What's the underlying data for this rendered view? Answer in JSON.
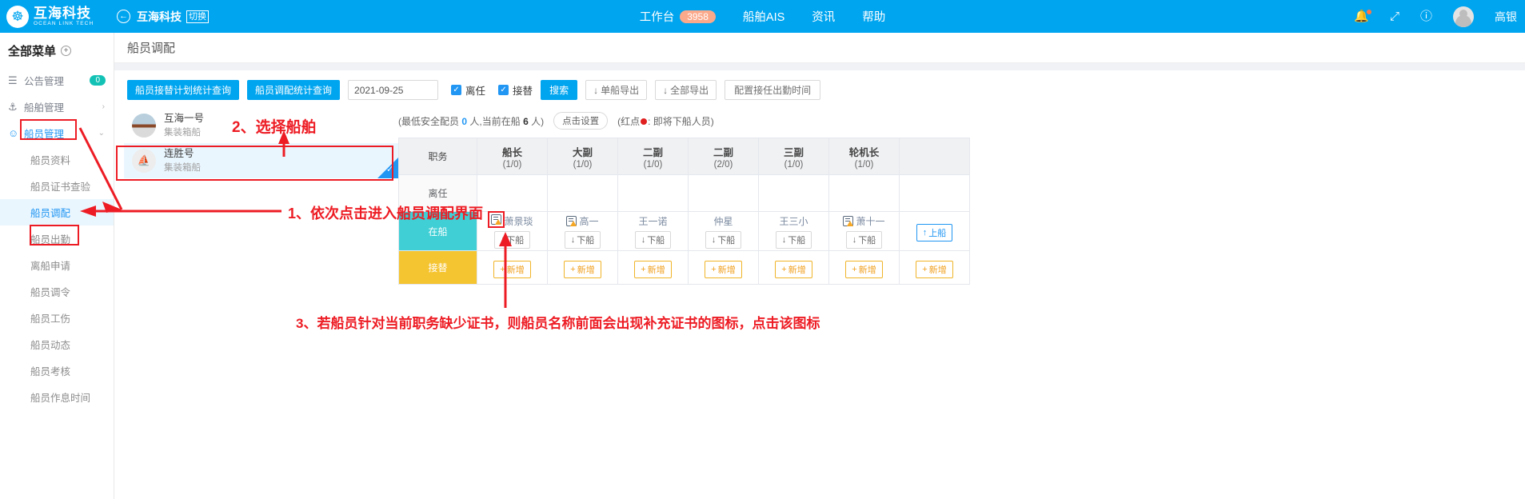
{
  "header": {
    "brand_cn": "互海科技",
    "brand_en": "OCEAN LINK TECH",
    "back_icon": "←",
    "back_name": "互海科技",
    "switch_label": "切换",
    "nav": [
      {
        "label": "工作台",
        "badge": "3958"
      },
      {
        "label": "船舶AIS",
        "badge": ""
      },
      {
        "label": "资讯",
        "badge": ""
      },
      {
        "label": "帮助",
        "badge": ""
      }
    ],
    "bell_icon": "🔔",
    "expand_icon": "⤢",
    "help_icon": "?",
    "user_name": "高银"
  },
  "sidebar": {
    "title": "全部菜单",
    "add_icon": "+",
    "groups": [
      {
        "icon": "☷",
        "label": "公告管理",
        "badge": "0"
      },
      {
        "icon": "⚓",
        "label": "船舶管理",
        "arrow": "›"
      },
      {
        "icon": "☺",
        "label": "船员管理",
        "arrow": "⌄",
        "active": true
      }
    ],
    "sub_items": [
      {
        "label": "船员资料"
      },
      {
        "label": "船员证书查验"
      },
      {
        "label": "船员调配",
        "selected": true
      },
      {
        "label": "船员出勤"
      },
      {
        "label": "离船申请"
      },
      {
        "label": "船员调令"
      },
      {
        "label": "船员工伤"
      },
      {
        "label": "船员动态"
      },
      {
        "label": "船员考核"
      },
      {
        "label": "船员作息时间"
      }
    ]
  },
  "page": {
    "title": "船员调配"
  },
  "toolbar": {
    "btn_plan_query": "船员接替计划统计查询",
    "btn_alloc_query": "船员调配统计查询",
    "date_value": "2021-09-25",
    "chk_leave": "离任",
    "chk_replace": "接替",
    "chk_mark": "✓",
    "btn_search": "搜索",
    "btn_single_export": "单船导出",
    "btn_all_export": "全部导出",
    "btn_config_time": "配置接任出勤时间",
    "download_icon": "↓"
  },
  "ships": [
    {
      "name": "互海一号",
      "type": "集装箱船",
      "selected": false
    },
    {
      "name": "连胜号",
      "type": "集装箱船",
      "selected": true
    }
  ],
  "table_note": {
    "prefix": "(最低安全配员",
    "min_crew": "0",
    "mid": "人,当前在船",
    "onboard_count": "6",
    "suffix": "人)",
    "setting_btn": "点击设置",
    "legend": "(红点",
    "legend_tail": ": 即将下船人员)"
  },
  "table": {
    "row_header_label": "职务",
    "columns": [
      {
        "name": "船长",
        "count": "(1/0)"
      },
      {
        "name": "大副",
        "count": "(1/0)"
      },
      {
        "name": "二副",
        "count": "(1/0)"
      },
      {
        "name": "二副",
        "count": "(2/0)"
      },
      {
        "name": "三副",
        "count": "(1/0)"
      },
      {
        "name": "轮机长",
        "count": "(1/0)"
      }
    ],
    "rows": [
      {
        "label": "离任",
        "style": "plain",
        "cells": [
          {
            "name": "",
            "cert": false,
            "button": ""
          },
          {
            "name": "",
            "cert": false,
            "button": ""
          },
          {
            "name": "",
            "cert": false,
            "button": ""
          },
          {
            "name": "",
            "cert": false,
            "button": ""
          },
          {
            "name": "",
            "cert": false,
            "button": ""
          },
          {
            "name": "",
            "cert": false,
            "button": ""
          }
        ]
      },
      {
        "label": "在船",
        "style": "onboard",
        "cells": [
          {
            "name": "萧景琰",
            "cert": true,
            "button": "下船",
            "highlight": true
          },
          {
            "name": "高一",
            "cert": true,
            "button": "下船"
          },
          {
            "name": "王一诺",
            "cert": false,
            "button": "下船"
          },
          {
            "name": "仲星",
            "cert": false,
            "button": "下船"
          },
          {
            "name": "王三小",
            "cert": false,
            "button": "下船"
          },
          {
            "name": "萧十一",
            "cert": true,
            "button": "下船"
          },
          {
            "name": "",
            "cert": false,
            "button": "上船",
            "button_style": "up"
          }
        ]
      },
      {
        "label": "接替",
        "style": "replace",
        "cells": [
          {
            "name": "",
            "cert": false,
            "button": "新增",
            "button_style": "add"
          },
          {
            "name": "",
            "cert": false,
            "button": "新增",
            "button_style": "add"
          },
          {
            "name": "",
            "cert": false,
            "button": "新增",
            "button_style": "add"
          },
          {
            "name": "",
            "cert": false,
            "button": "新增",
            "button_style": "add"
          },
          {
            "name": "",
            "cert": false,
            "button": "新增",
            "button_style": "add"
          },
          {
            "name": "",
            "cert": false,
            "button": "新增",
            "button_style": "add"
          },
          {
            "name": "",
            "cert": false,
            "button": "新增",
            "button_style": "add"
          }
        ]
      }
    ],
    "down_arrow": "↓",
    "up_arrow": "↑",
    "plus": "+"
  },
  "annotations": {
    "step1": "1、依次点击进入船员调配界面",
    "step2": "2、选择船舶",
    "step3": "3、若船员针对当前职务缺少证书，则船员名称前面会出现补充证书的图标，点击该图标"
  },
  "colors": {
    "brand_blue": "#00A5F0",
    "accent_blue": "#2196F3",
    "annotation_red": "#ED1C24",
    "onboard_teal": "#3FCFD5",
    "replace_yellow": "#F5C431",
    "badge_orange": "#FBA98B"
  }
}
